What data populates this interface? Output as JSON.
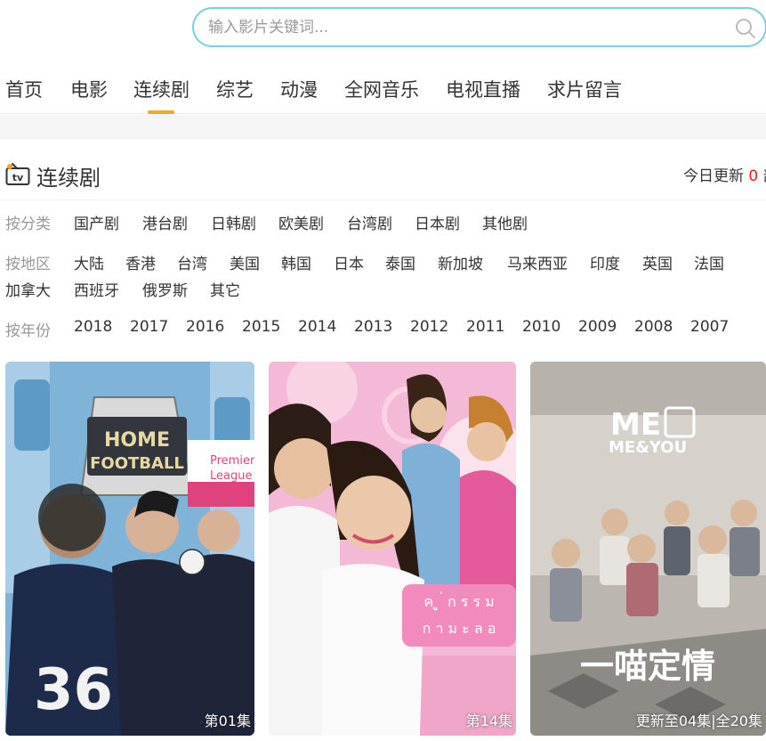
{
  "search": {
    "placeholder": "输入影片关键词...",
    "value": ""
  },
  "nav": {
    "items": [
      "首页",
      "电影",
      "连续剧",
      "综艺",
      "动漫",
      "全网音乐",
      "电视直播",
      "求片留言"
    ],
    "active": "连续剧",
    "accent": "#f5a623"
  },
  "section": {
    "title": "连续剧",
    "update_prefix": "今日更新",
    "update_count": "0",
    "update_suffix": "部"
  },
  "filters": {
    "category": {
      "label": "按分类",
      "items": [
        "国产剧",
        "港台剧",
        "日韩剧",
        "欧美剧",
        "台湾剧",
        "日本剧",
        "其他剧"
      ]
    },
    "region": {
      "label": "按地区",
      "items": [
        "大陆",
        "香港",
        "台湾",
        "美国",
        "韩国",
        "日本",
        "泰国",
        "新加坡",
        "马来西亚",
        "印度",
        "英国",
        "法国",
        "加拿大",
        "西班牙",
        "俄罗斯",
        "其它"
      ]
    },
    "year": {
      "label": "按年份",
      "items": [
        "2018",
        "2017",
        "2016",
        "2015",
        "2014",
        "2013",
        "2012",
        "2011",
        "2010",
        "2009",
        "2008",
        "2007"
      ]
    }
  },
  "cards": [
    {
      "caption": "第01集",
      "poster_texts": [
        "HOME",
        "FOOTBALL",
        "Premier",
        "League",
        "36"
      ]
    },
    {
      "caption": "第14集",
      "poster_texts": []
    },
    {
      "caption": "更新至04集|全20集",
      "poster_texts": [
        "ME",
        "ME&YOU",
        "一喵定情"
      ]
    }
  ],
  "colors": {
    "search_border": "#7ecfdc",
    "update_count": "#e02020",
    "tv_icon_accent": "#f5a623"
  }
}
